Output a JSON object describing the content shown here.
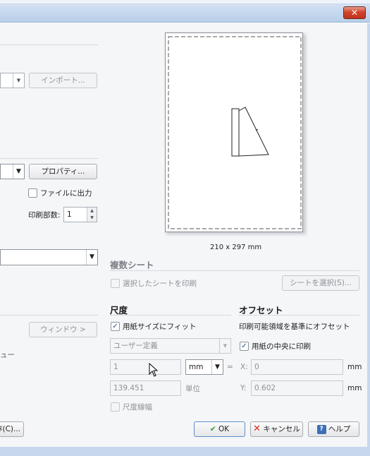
{
  "window": {
    "close_label": "✕"
  },
  "left": {
    "import_button": "インポート...",
    "properties_button": "プロパティ...",
    "print_to_file_label": "ファイルに出力",
    "copies_label": "印刷部数:",
    "copies_value": "1",
    "window_button": "ウィンドウ >",
    "truncated_text": "ュー",
    "save_button_partial": "存(C)..."
  },
  "preview": {
    "page_size_label": "210 x 297 mm"
  },
  "multi_sheet": {
    "heading": "複数シート",
    "print_selected_label": "選択したシートを印刷",
    "select_sheets_button": "シートを選択(S)..."
  },
  "scale": {
    "heading": "尺度",
    "fit_to_paper_label": "用紙サイズにフィット",
    "fit_to_paper_checked": true,
    "preset_value": "ユーザー定義",
    "value_input": "1",
    "unit_select": "mm",
    "equals": "=",
    "computed_value": "139.451",
    "unit_label": "単位",
    "lineweight_label": "尺度線幅"
  },
  "offset": {
    "heading": "オフセット",
    "basis_text": "印刷可能領域を基準にオフセット",
    "center_label": "用紙の中央に印刷",
    "center_checked": true,
    "x_label": "X:",
    "x_value": "0",
    "x_unit": "mm",
    "y_label": "Y:",
    "y_value": "0.602",
    "y_unit": "mm"
  },
  "footer": {
    "ok_button": "OK",
    "cancel_button": "キャンセル",
    "help_button": "ヘルプ"
  },
  "colors": {
    "accent": "#1d4f8a",
    "ok_check": "#3a9b2a",
    "cancel_x": "#d42a1c",
    "help_icon": "#3c6fb5"
  }
}
